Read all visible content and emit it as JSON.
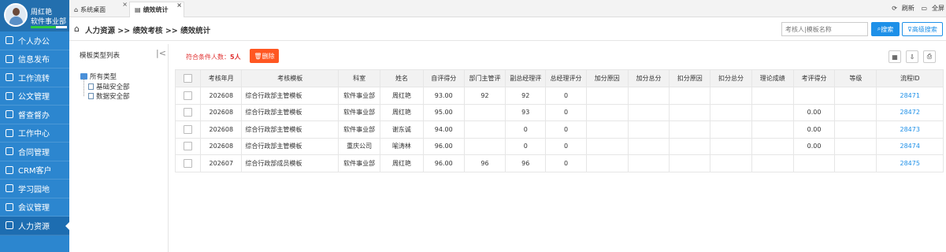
{
  "user": {
    "name": "周红艳",
    "dept": "软件事业部",
    "progress": 0.7
  },
  "sidebar": {
    "items": [
      {
        "label": "个人办公",
        "active": false
      },
      {
        "label": "信息发布",
        "active": false
      },
      {
        "label": "工作流转",
        "active": false
      },
      {
        "label": "公文管理",
        "active": false
      },
      {
        "label": "督查督办",
        "active": false
      },
      {
        "label": "工作中心",
        "active": false
      },
      {
        "label": "合同管理",
        "active": false
      },
      {
        "label": "CRM客户",
        "active": false
      },
      {
        "label": "学习园地",
        "active": false
      },
      {
        "label": "会议管理",
        "active": false
      },
      {
        "label": "人力资源",
        "active": true
      }
    ]
  },
  "tabs": [
    {
      "label": "系统桌面",
      "icon": "home-icon"
    },
    {
      "label": "绩效统计",
      "icon": "document-icon"
    }
  ],
  "tab_tools": {
    "refresh": "刷新",
    "fullscreen": "全屏"
  },
  "breadcrumb": "人力资源 >> 绩效考核 >> 绩效统计",
  "search": {
    "placeholder": "考核人|模板名称",
    "search_label": "搜索",
    "advanced_label": "高级搜索"
  },
  "tree": {
    "title": "模板类型列表",
    "root": "所有类型",
    "children": [
      "基础安全部",
      "数据安全部"
    ]
  },
  "toolbar": {
    "count_prefix": "符合条件人数：",
    "count_value": "5人",
    "delete_label": "删除"
  },
  "table": {
    "columns": [
      "考核年月",
      "考核模板",
      "科室",
      "姓名",
      "自评得分",
      "部门主管评",
      "副总经理评",
      "总经理评分",
      "加分原因",
      "加分总分",
      "扣分原因",
      "扣分总分",
      "理论成绩",
      "考评得分",
      "等级",
      "流程ID"
    ],
    "rows": [
      [
        "202608",
        "综合行政部主管模板",
        "软件事业部",
        "周红艳",
        "93.00",
        "92",
        "92",
        "0",
        "",
        "",
        "",
        "",
        "",
        "",
        "",
        "28471"
      ],
      [
        "202608",
        "综合行政部主管模板",
        "软件事业部",
        "周红艳",
        "95.00",
        "",
        "93",
        "0",
        "",
        "",
        "",
        "",
        "",
        "0.00",
        "",
        "28472"
      ],
      [
        "202608",
        "综合行政部主管模板",
        "软件事业部",
        "谢东诚",
        "94.00",
        "",
        "0",
        "0",
        "",
        "",
        "",
        "",
        "",
        "0.00",
        "",
        "28473"
      ],
      [
        "202608",
        "综合行政部主管模板",
        "重庆公司",
        "喻涛林",
        "96.00",
        "",
        "0",
        "0",
        "",
        "",
        "",
        "",
        "",
        "0.00",
        "",
        "28474"
      ],
      [
        "202607",
        "综合行政部成员模板",
        "软件事业部",
        "周红艳",
        "96.00",
        "96",
        "96",
        "0",
        "",
        "",
        "",
        "",
        "",
        "",
        "",
        "28475"
      ]
    ]
  }
}
